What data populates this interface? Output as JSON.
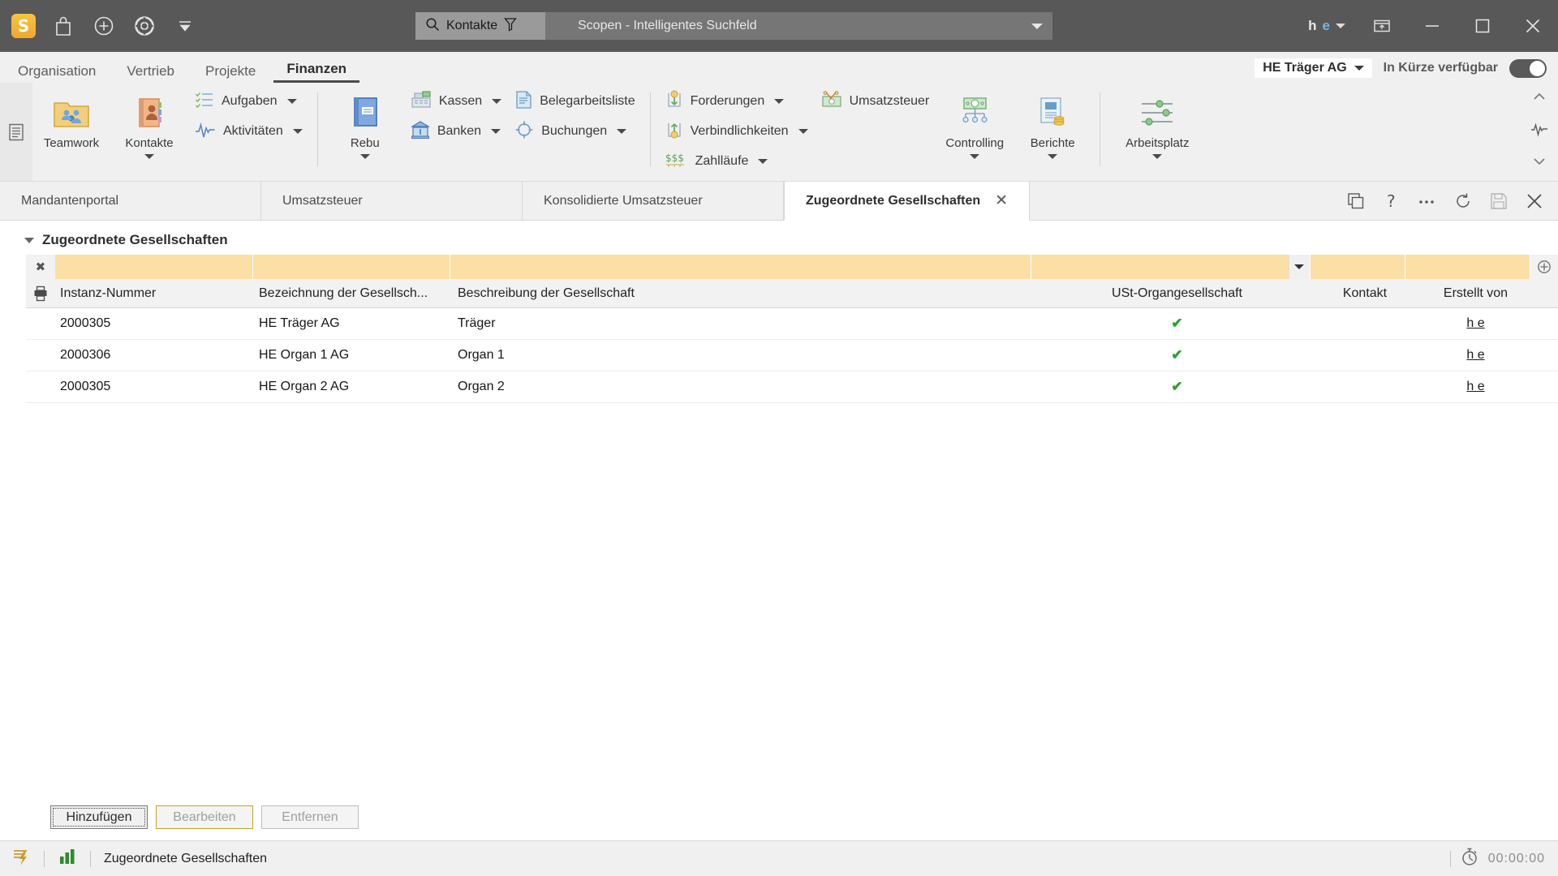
{
  "titlebar": {
    "logo": "S",
    "icons": [
      "bag-icon",
      "plus-circle-icon",
      "lifebuoy-icon",
      "collapse-icon"
    ],
    "search": {
      "scope_label": "Kontakte",
      "search_icon": "search-icon",
      "filter_icon": "filter-icon",
      "placeholder": "Scopen - Intelligentes Suchfeld",
      "dropdown_icon": "chevron-down-icon"
    },
    "user": {
      "initial_1": "h",
      "initial_2": "e"
    },
    "window_icons": [
      "restore-down-icon",
      "minimize-icon",
      "maximize-icon",
      "close-icon"
    ]
  },
  "ribbon": {
    "tabs": [
      {
        "label": "Organisation",
        "active": false
      },
      {
        "label": "Vertrieb",
        "active": false
      },
      {
        "label": "Projekte",
        "active": false
      },
      {
        "label": "Finanzen",
        "active": true
      }
    ],
    "company_selector": "HE Träger AG",
    "availability_label": "In Kürze verfügbar",
    "toggle_state": "on",
    "groups": {
      "big1": [
        {
          "label": "Teamwork",
          "icon": "teamwork-folder-icon",
          "has_caret": false
        },
        {
          "label": "Kontakte",
          "icon": "contacts-book-icon",
          "has_caret": true
        }
      ],
      "small1": [
        {
          "label": "Aufgaben",
          "icon": "tasks-list-icon",
          "has_caret": true
        },
        {
          "label": "Aktivitäten",
          "icon": "activity-pulse-icon",
          "has_caret": true
        }
      ],
      "big2": [
        {
          "label": "Rebu",
          "icon": "ledger-book-icon",
          "has_caret": true
        }
      ],
      "small2": [
        {
          "label": "Kassen",
          "icon": "cash-register-icon",
          "has_caret": true
        },
        {
          "label": "Banken",
          "icon": "bank-icon",
          "has_caret": true
        }
      ],
      "small3": [
        {
          "label": "Belegarbeitsliste",
          "icon": "document-list-icon",
          "has_caret": false
        },
        {
          "label": "Buchungen",
          "icon": "target-icon",
          "has_caret": true
        }
      ],
      "small4": [
        {
          "label": "Forderungen",
          "icon": "receivables-icon",
          "has_caret": true
        },
        {
          "label": "Verbindlichkeiten",
          "icon": "payables-icon",
          "has_caret": true
        },
        {
          "label": "Zahlläufe",
          "icon": "money-flow-icon",
          "has_caret": true
        }
      ],
      "small5": [
        {
          "label": "Umsatzsteuer",
          "icon": "vat-scissors-icon",
          "has_caret": false
        }
      ],
      "big3": [
        {
          "label": "Controlling",
          "icon": "controlling-chart-icon",
          "has_caret": true
        },
        {
          "label": "Berichte",
          "icon": "reports-icon",
          "has_caret": true
        }
      ],
      "big4": [
        {
          "label": "Arbeitsplatz",
          "icon": "sliders-icon",
          "has_caret": true
        }
      ]
    }
  },
  "doctabs": {
    "tabs": [
      {
        "label": "Mandantenportal",
        "active": false,
        "closable": false
      },
      {
        "label": "Umsatzsteuer",
        "active": false,
        "closable": false
      },
      {
        "label": "Konsolidierte Umsatzsteuer",
        "active": false,
        "closable": false
      },
      {
        "label": "Zugeordnete Gesellschaften",
        "active": true,
        "closable": true,
        "close_glyph": "✕"
      }
    ],
    "actions": [
      "duplicate-icon",
      "help-icon",
      "more-icon",
      "refresh-icon",
      "save-icon",
      "close-icon"
    ]
  },
  "panel": {
    "title": "Zugeordnete Gesellschaften",
    "collapse_icon": "triangle-down-icon",
    "clear_filter_glyph": "✖",
    "print_icon": "printer-icon",
    "add_column_glyph": "⊕",
    "filter_dropdown_icon": "chevron-down-icon",
    "filter_values": [
      "",
      "",
      "",
      "",
      "",
      ""
    ],
    "columns": [
      "Instanz-Nummer",
      "Bezeichnung der Gesellsch...",
      "Beschreibung der Gesellschaft",
      "USt-Organgesellschaft",
      "Kontakt",
      "Erstellt von"
    ],
    "rows": [
      {
        "instanz": "2000305",
        "bezeichnung": "HE Träger AG",
        "beschreibung": "Träger",
        "ust": "✔",
        "kontakt": "",
        "erstellt_von": "h e"
      },
      {
        "instanz": "2000306",
        "bezeichnung": "HE Organ 1 AG",
        "beschreibung": "Organ 1",
        "ust": "✔",
        "kontakt": "",
        "erstellt_von": "h e"
      },
      {
        "instanz": "2000305",
        "bezeichnung": "HE Organ 2 AG",
        "beschreibung": "Organ 2",
        "ust": "✔",
        "kontakt": "",
        "erstellt_von": "h e"
      }
    ],
    "buttons": [
      {
        "label": "Hinzufügen",
        "state": "focused"
      },
      {
        "label": "Bearbeiten",
        "state": "disabled-warn"
      },
      {
        "label": "Entfernen",
        "state": "disabled"
      }
    ]
  },
  "statusbar": {
    "lightning_icon": "lightning-note-icon",
    "chart_icon": "bar-chart-icon",
    "text": "Zugeordnete Gesellschaften",
    "timer_icon": "stopwatch-icon",
    "timer": "00:00:00"
  },
  "colors": {
    "titlebar_bg": "#585858",
    "ribbon_bg": "#f0f0f0",
    "filter_yellow": "#fbdfa5",
    "check_green": "#2f9e2f",
    "accent_gold": "#efa92c"
  }
}
